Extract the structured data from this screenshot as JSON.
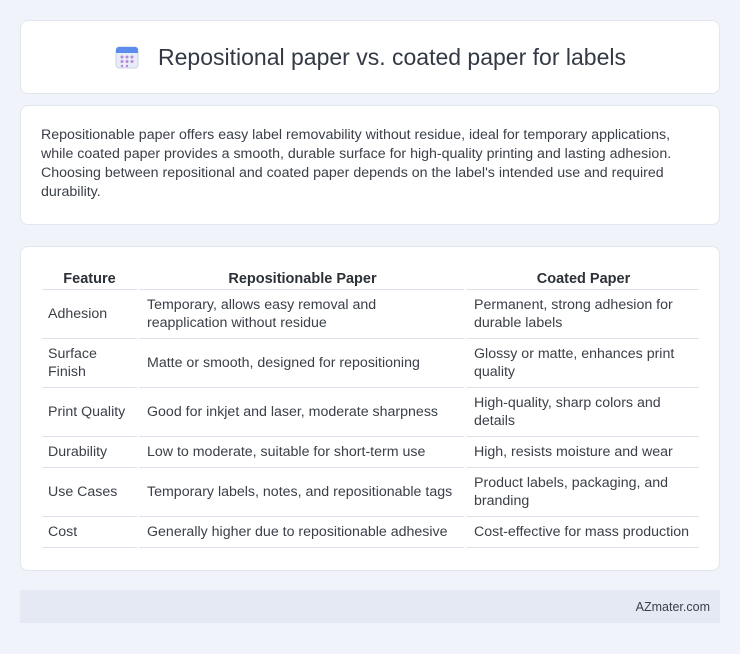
{
  "header": {
    "title": "Repositional paper vs. coated paper for labels",
    "icon": "calendar-icon",
    "icon_colors": {
      "top": "#5b8def",
      "body": "#e8edf7",
      "dots": "#b58ad8"
    }
  },
  "intro": {
    "text": "Repositionable paper offers easy label removability without residue, ideal for temporary applications, while coated paper provides a smooth, durable surface for high-quality printing and lasting adhesion. Choosing between repositional and coated paper depends on the label's intended use and required durability."
  },
  "table": {
    "headers": [
      "Feature",
      "Repositionable Paper",
      "Coated Paper"
    ],
    "rows": [
      [
        "Adhesion",
        "Temporary, allows easy removal and reapplication without residue",
        "Permanent, strong adhesion for durable labels"
      ],
      [
        "Surface Finish",
        "Matte or smooth, designed for repositioning",
        "Glossy or matte, enhances print quality"
      ],
      [
        "Print Quality",
        "Good for inkjet and laser, moderate sharpness",
        "High-quality, sharp colors and details"
      ],
      [
        "Durability",
        "Low to moderate, suitable for short-term use",
        "High, resists moisture and wear"
      ],
      [
        "Use Cases",
        "Temporary labels, notes, and repositionable tags",
        "Product labels, packaging, and branding"
      ],
      [
        "Cost",
        "Generally higher due to repositionable adhesive",
        "Cost-effective for mass production"
      ]
    ]
  },
  "footer": {
    "brand": "AZmater.com"
  }
}
